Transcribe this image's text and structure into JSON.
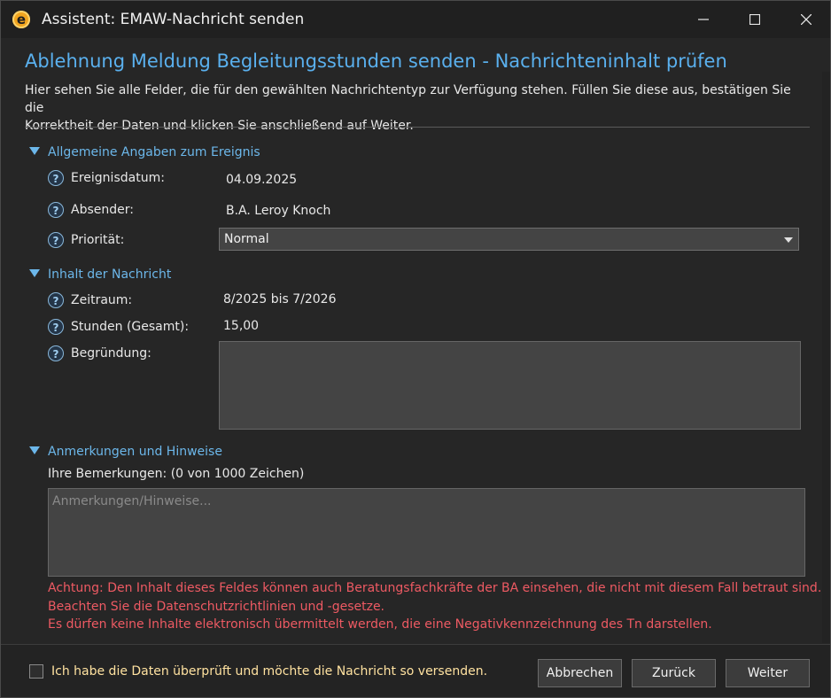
{
  "window": {
    "title": "Assistent: EMAW-Nachricht senden",
    "icon_letter": "e"
  },
  "header": {
    "title": "Ablehnung Meldung Begleitungsstunden senden - Nachrichteninhalt prüfen",
    "description_line1": "Hier sehen Sie alle Felder, die für den gewählten Nachrichtentyp zur Verfügung stehen. Füllen Sie diese aus, bestätigen Sie die",
    "description_line2": "Korrektheit der Daten und klicken Sie anschließend auf Weiter."
  },
  "sections": {
    "general": {
      "title": "Allgemeine Angaben zum Ereignis",
      "event_date_label": "Ereignisdatum:",
      "event_date_value": "04.09.2025",
      "sender_label": "Absender:",
      "sender_value": "B.A. Leroy Knoch",
      "priority_label": "Priorität:",
      "priority_value": "Normal"
    },
    "content": {
      "title": "Inhalt der Nachricht",
      "period_label": "Zeitraum:",
      "period_value": "8/2025 bis 7/2026",
      "hours_label": "Stunden (Gesamt):",
      "hours_value": "15,00",
      "reason_label": "Begründung:",
      "reason_value": ""
    },
    "remarks": {
      "title": "Anmerkungen und Hinweise",
      "label": "Ihre Bemerkungen: (0 von 1000 Zeichen)",
      "placeholder": "Anmerkungen/Hinweise...",
      "warning_line1": "Achtung: Den Inhalt dieses Feldes können auch Beratungsfachkräfte der BA einsehen, die nicht mit diesem Fall betraut sind.",
      "warning_line2": "Beachten Sie die Datenschutzrichtlinien und -gesetze.",
      "warning_line3": "Es dürfen keine Inhalte elektronisch übermittelt werden, die eine Negativkennzeichnung des Tn darstellen."
    }
  },
  "help_icon_glyph": "?",
  "footer": {
    "confirm_label": "Ich habe die Daten überprüft und möchte die Nachricht so versenden.",
    "confirm_checked": false,
    "cancel_label": "Abbrechen",
    "back_label": "Zurück",
    "next_label": "Weiter"
  },
  "colors": {
    "accent": "#5ab0ee",
    "warning": "#ee5a63",
    "checkbox_label": "#ffe2a0"
  }
}
